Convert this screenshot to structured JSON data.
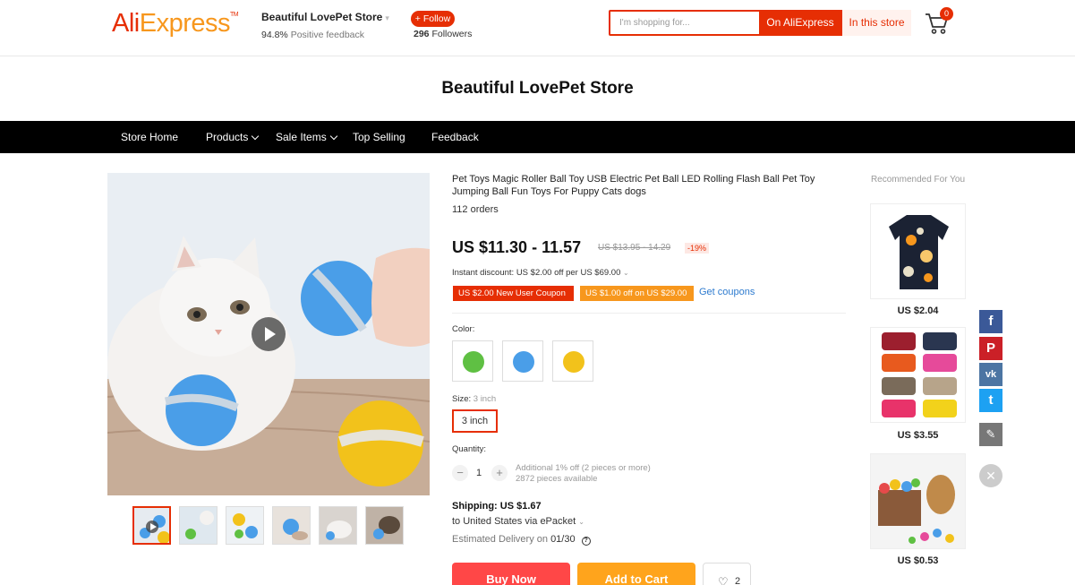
{
  "header": {
    "logo_part1": "Ali",
    "logo_part2": "Express",
    "logo_tm": "TM",
    "store_name": "Beautiful LovePet Store",
    "feedback_value": "94.8%",
    "feedback_label": "Positive feedback",
    "follow_label": "+ Follow",
    "followers_count": "296",
    "followers_label": "Followers",
    "search_placeholder": "I'm shopping for...",
    "search_ali_label": "On AliExpress",
    "search_store_label": "In this store",
    "cart_count": "0"
  },
  "store_title": "Beautiful LovePet Store",
  "nav": {
    "items": [
      {
        "label": "Store Home"
      },
      {
        "label": "Products"
      },
      {
        "label": "Sale Items"
      },
      {
        "label": "Top Selling"
      },
      {
        "label": "Feedback"
      }
    ]
  },
  "product": {
    "title": "Pet Toys Magic Roller Ball Toy USB Electric Pet Ball LED Rolling Flash Ball Pet Toy Jumping Ball Fun Toys For Puppy Cats dogs",
    "orders": "112 orders",
    "price": "US $11.30 - 11.57",
    "old_price": "US $13.95 - 14.29",
    "discount_pct": "-19%",
    "instant_discount": "Instant discount: US $2.00 off per US $69.00",
    "coupon1": "US $2.00 New User Coupon",
    "coupon2": "US $1.00 off on US $29.00",
    "get_coupons": "Get coupons",
    "color_label": "Color:",
    "colors": [
      {
        "name": "green",
        "hex": "#5fc043"
      },
      {
        "name": "blue",
        "hex": "#4a9ee8"
      },
      {
        "name": "yellow",
        "hex": "#f2c21b"
      }
    ],
    "size_label": "Size:",
    "size_selected": "3 inch",
    "size_option": "3 inch",
    "quantity_label": "Quantity:",
    "quantity_minus": "−",
    "quantity_value": "1",
    "quantity_plus": "+",
    "quantity_note1": "Additional 1% off (2 pieces or more)",
    "quantity_note2": "2872 pieces available",
    "shipping_price": "Shipping: US $1.67",
    "shipping_dest": "to United States via ePacket",
    "delivery_label": "Estimated Delivery on",
    "delivery_date": "01/30",
    "buy_now": "Buy Now",
    "add_to_cart": "Add to Cart",
    "wish_count": "2"
  },
  "recommended": {
    "title": "Recommended For You",
    "items": [
      {
        "price": "US $2.04"
      },
      {
        "price": "US $3.55"
      },
      {
        "price": "US $0.53"
      }
    ]
  },
  "share": {
    "facebook": "f",
    "pinterest": "P",
    "vk": "vk",
    "twitter": "t",
    "edit": "✎",
    "close": "✕"
  },
  "colors": {
    "accent": "#e62e04",
    "orange": "#f7971d",
    "buy_now": "#ff4747",
    "add_to_cart": "#ffa41c",
    "link": "#2e7bcf",
    "facebook": "#3b5998",
    "pinterest": "#cb2027",
    "vk": "#4c75a3",
    "twitter": "#1da1f2",
    "edit": "#777777"
  }
}
